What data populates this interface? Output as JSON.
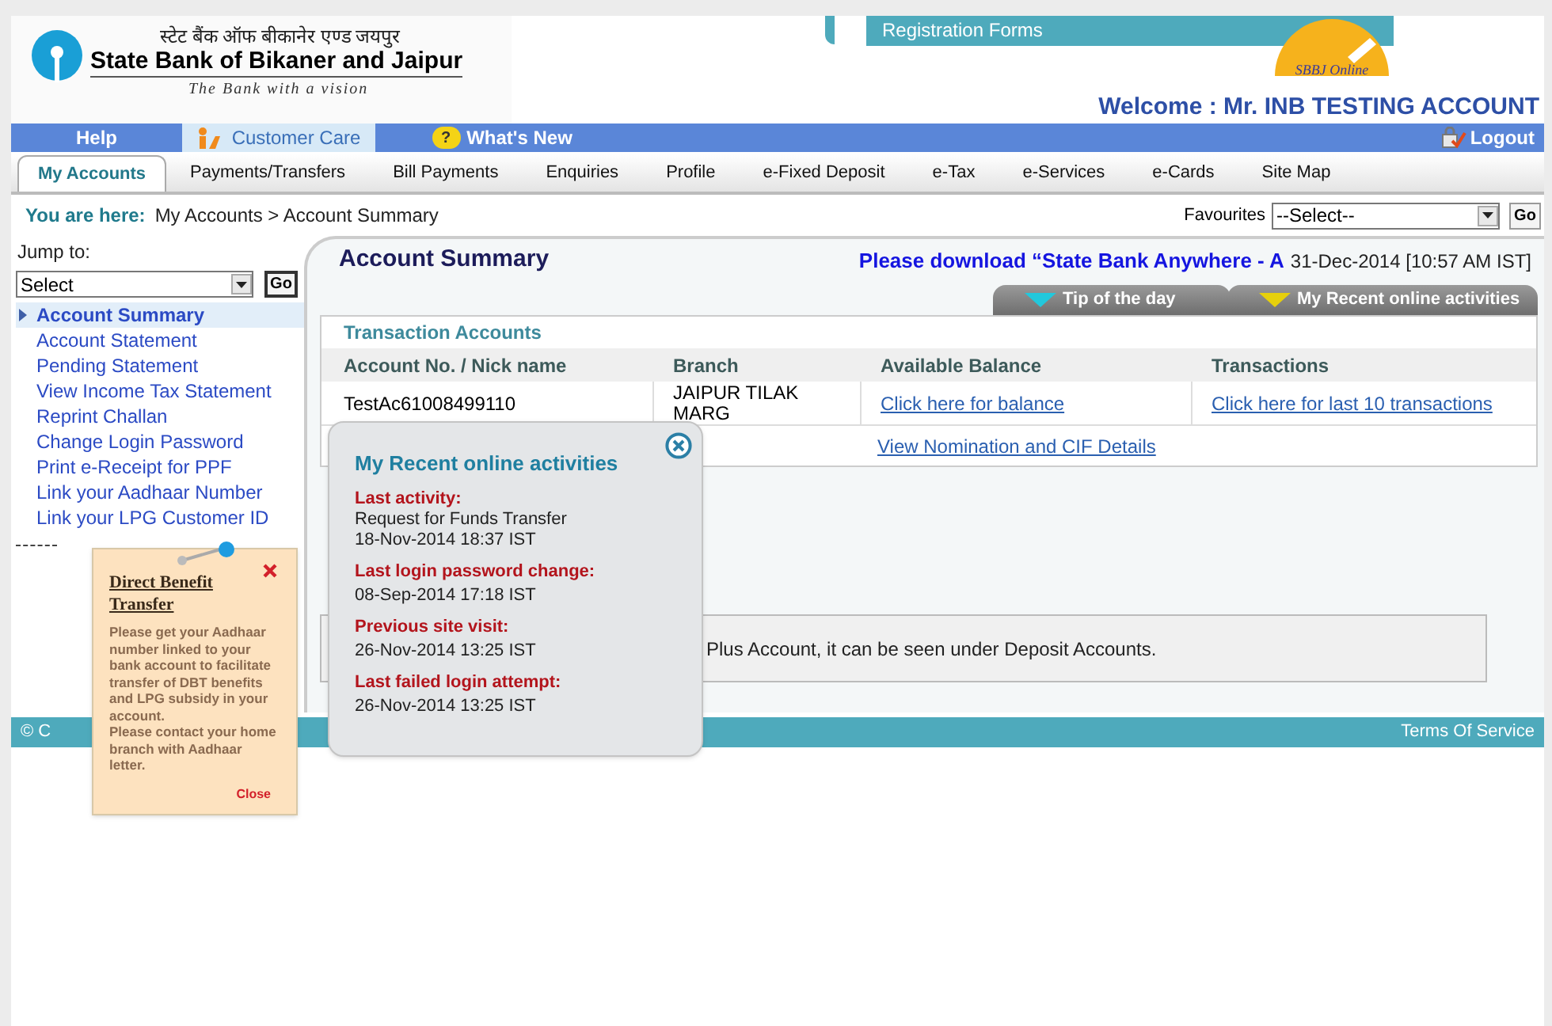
{
  "header": {
    "hindi_name": "स्टेट बैंक ऑफ बीकानेर एण्ड जयपुर",
    "bank_name": "State Bank of Bikaner and Jaipur",
    "tagline": "The Bank with a vision",
    "registration_link": "Registration Forms",
    "online_logo": "SBBJ Online",
    "welcome": "Welcome : Mr. INB TESTING ACCOUNT"
  },
  "top_links": [
    {
      "label": "Help",
      "kind": "plain",
      "selected": false
    },
    {
      "label": "Customer Care",
      "kind": "care",
      "selected": true
    },
    {
      "label": "What's New",
      "kind": "new",
      "selected": false,
      "icon": "?"
    }
  ],
  "logout": "Logout",
  "menu": [
    {
      "label": "My Accounts",
      "selected": true
    },
    {
      "label": "Payments/Transfers",
      "selected": false
    },
    {
      "label": "Bill Payments",
      "selected": false
    },
    {
      "label": "Enquiries",
      "selected": false
    },
    {
      "label": "Profile",
      "selected": false
    },
    {
      "label": "e-Fixed Deposit",
      "selected": false
    },
    {
      "label": "e-Tax",
      "selected": false
    },
    {
      "label": "e-Services",
      "selected": false
    },
    {
      "label": "e-Cards",
      "selected": false
    },
    {
      "label": "Site Map",
      "selected": false
    }
  ],
  "breadcrumb": {
    "label": "You are here:",
    "path": "My Accounts > Account Summary"
  },
  "favourites": {
    "label": "Favourites",
    "value": "--Select--",
    "button": "Go"
  },
  "sidebar": {
    "jump_label": "Jump to:",
    "select_value": "Select",
    "button": "Go",
    "items": [
      {
        "label": "Account Summary",
        "selected": true
      },
      {
        "label": "Account Statement",
        "selected": false
      },
      {
        "label": "Pending Statement",
        "selected": false
      },
      {
        "label": "View Income Tax Statement",
        "selected": false
      },
      {
        "label": "Reprint Challan",
        "selected": false
      },
      {
        "label": "Change Login Password",
        "selected": false
      },
      {
        "label": "Print e-Receipt for PPF",
        "selected": false
      },
      {
        "label": "Link your Aadhaar Number",
        "selected": false
      },
      {
        "label": "Link your LPG Customer ID",
        "selected": false
      }
    ]
  },
  "main": {
    "title": "Account Summary",
    "marquee": "Please download “State Bank Anywhere - A",
    "date": "31-Dec-2014 [10:57 AM IST]",
    "panel_tabs": [
      {
        "label": "Tip of the day",
        "color": "#22c8dc"
      },
      {
        "label": "My Recent online activities",
        "color": "#e6d00c"
      }
    ],
    "table": {
      "section": "Transaction Accounts",
      "columns": [
        "Account No. / Nick name",
        "Branch",
        "Available Balance",
        "Transactions"
      ],
      "rows": [
        {
          "account": "TestAc61008499110",
          "branch": "JAIPUR TILAK MARG",
          "balance": "Click here for balance",
          "transactions": "Click here for last 10 transactions"
        }
      ],
      "nomination": "View Nomination and CIF Details"
    },
    "note": "Plus Account, it can be seen under Deposit Accounts."
  },
  "footer": {
    "copyright": "© C",
    "terms": "Terms Of Service"
  },
  "recent_popup": {
    "title": "My Recent online activities",
    "entries": [
      {
        "label": "Last activity:",
        "lines": [
          "Request for Funds Transfer",
          "18-Nov-2014 18:37 IST"
        ]
      },
      {
        "label": "Last login password change:",
        "lines": [
          "08-Sep-2014 17:18 IST"
        ]
      },
      {
        "label": "Previous site visit:",
        "lines": [
          "26-Nov-2014 13:25 IST"
        ]
      },
      {
        "label": "Last failed login attempt:",
        "lines": [
          "26-Nov-2014 13:25 IST"
        ]
      }
    ]
  },
  "dbt_popup": {
    "title": "Direct Benefit Transfer",
    "body": [
      "Please get your Aadhaar number linked to your bank account to facilitate transfer of DBT benefits and LPG subsidy in your account.",
      "Please contact your home branch with Aadhaar letter."
    ],
    "close": "Close"
  }
}
